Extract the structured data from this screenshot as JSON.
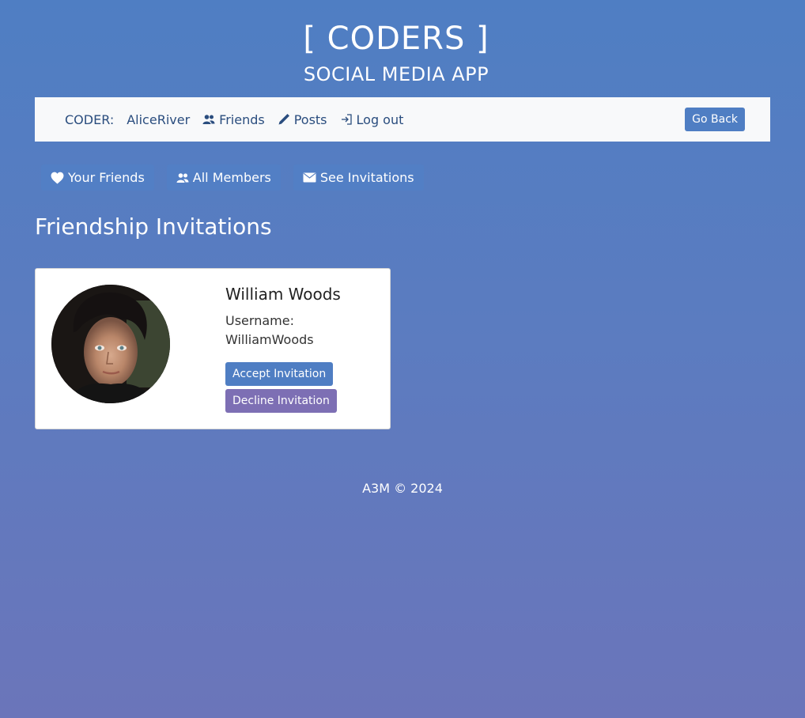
{
  "header": {
    "title": "[ CODERS ]",
    "subtitle": "SOCIAL MEDIA APP"
  },
  "navbar": {
    "coder_label": "CODER:",
    "username": "AliceRiver",
    "items": [
      {
        "label": "Friends",
        "icon": "people-icon"
      },
      {
        "label": "Posts",
        "icon": "pencil-icon"
      },
      {
        "label": "Log out",
        "icon": "logout-icon"
      }
    ],
    "go_back": "Go Back"
  },
  "tabs": [
    {
      "label": "Your Friends",
      "icon": "heart-icon"
    },
    {
      "label": "All Members",
      "icon": "people-icon"
    },
    {
      "label": "See Invitations",
      "icon": "envelope-icon"
    }
  ],
  "section_title": "Friendship Invitations",
  "invitation": {
    "name": "William Woods",
    "username_label": "Username:",
    "username": "WilliamWoods",
    "accept_label": "Accept Invitation",
    "decline_label": "Decline Invitation"
  },
  "footer": "A3M © 2024",
  "colors": {
    "primary": "#4f7ec3",
    "decline": "#7d6fb4",
    "nav_text": "#2a4d7e"
  }
}
